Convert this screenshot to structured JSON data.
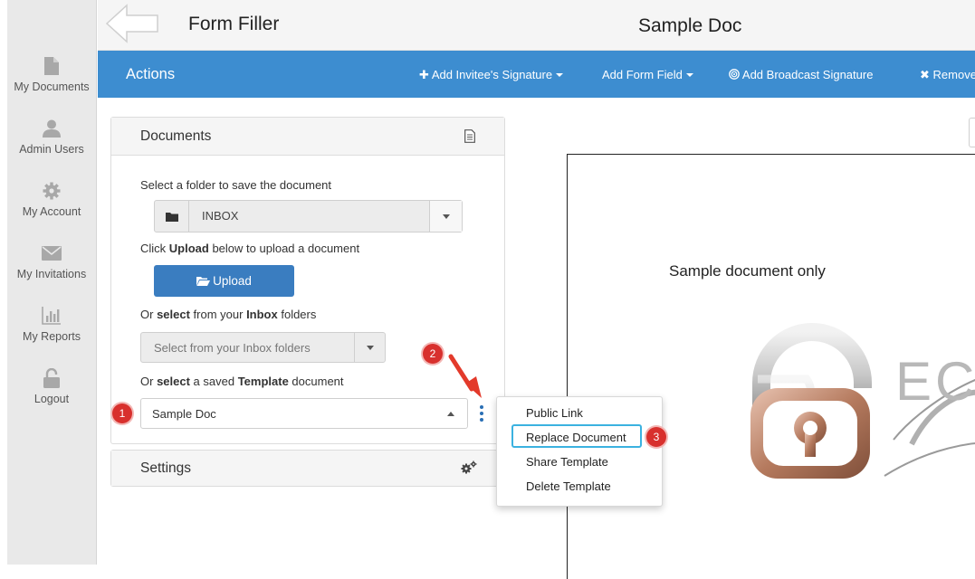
{
  "sidebar": {
    "items": [
      {
        "label": "My Documents",
        "icon": "document-icon"
      },
      {
        "label": "Admin Users",
        "icon": "user-icon"
      },
      {
        "label": "My Account",
        "icon": "gear-icon"
      },
      {
        "label": "My Invitations",
        "icon": "envelope-icon"
      },
      {
        "label": "My Reports",
        "icon": "bar-chart-icon"
      },
      {
        "label": "Logout",
        "icon": "unlock-icon"
      }
    ]
  },
  "header": {
    "app_title": "Form Filler",
    "doc_title": "Sample Doc"
  },
  "actionbar": {
    "title": "Actions",
    "add_invitee_signature": "Add Invitee's Signature",
    "add_form_field": "Add Form Field",
    "add_broadcast_signature": "Add Broadcast Signature",
    "remove": "Remove"
  },
  "documents_panel": {
    "title": "Documents",
    "select_folder_text": "Select a folder to save the document",
    "folder_value": "INBOX",
    "upload_prefix": "Click ",
    "upload_bold": "Upload",
    "upload_suffix": " below to upload a document",
    "upload_button": "Upload",
    "inbox_prefix": "Or ",
    "inbox_bold1": "select",
    "inbox_mid": " from your ",
    "inbox_bold2": "Inbox",
    "inbox_suffix": " folders",
    "inbox_placeholder": "Select from your Inbox folders",
    "template_prefix": "Or ",
    "template_bold1": "select",
    "template_mid": " a saved ",
    "template_bold2": "Template",
    "template_suffix": " document",
    "template_value": "Sample Doc"
  },
  "settings_panel": {
    "title": "Settings"
  },
  "context_menu": {
    "items": [
      "Public Link",
      "Replace Document",
      "Share Template",
      "Delete Template"
    ]
  },
  "annotations": {
    "badge1": "1",
    "badge2": "2",
    "badge3": "3"
  },
  "document_preview": {
    "text": "Sample document only",
    "logo_letters": "EC"
  },
  "colors": {
    "action_bar": "#3d8dd0",
    "upload_button": "#3a7dc0",
    "badge": "#d8302d",
    "highlight": "#3bb2e0"
  }
}
